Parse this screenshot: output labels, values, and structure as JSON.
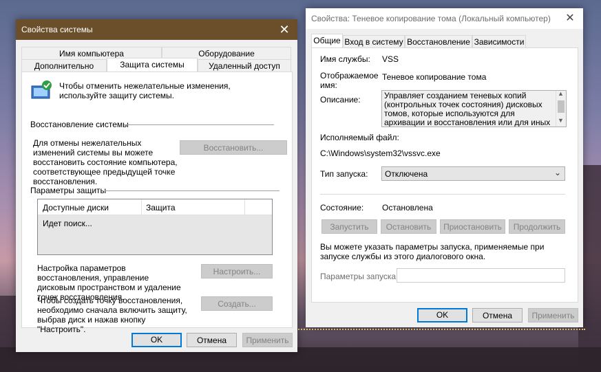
{
  "sys": {
    "title": "Свойства системы",
    "tabs_row1": [
      "Имя компьютера",
      "Оборудование"
    ],
    "tabs_row2": [
      "Дополнительно",
      "Защита системы",
      "Удаленный доступ"
    ],
    "intro": "Чтобы отменить нежелательные изменения, используйте защиту системы.",
    "restore_group": "Восстановление системы",
    "restore_text": "Для отмены нежелательных изменений системы вы можете восстановить состояние компьютера, соответствующее предыдущей точке восстановления.",
    "restore_button": "Восстановить...",
    "protection_group": "Параметры защиты",
    "table_headers": [
      "Доступные диски",
      "Защита"
    ],
    "table_status": "Идет поиск...",
    "configure_text": "Настройка параметров восстановления, управление дисковым пространством и удаление точек восстановления.",
    "configure_button": "Настроить...",
    "create_text": "Чтобы создать точку восстановления, необходимо сначала включить защиту, выбрав диск и нажав кнопку \"Настроить\".",
    "create_button": "Создать...",
    "ok": "OK",
    "cancel": "Отмена",
    "apply": "Применить"
  },
  "svc": {
    "title": "Свойства: Теневое копирование тома (Локальный компьютер)",
    "tabs": [
      "Общие",
      "Вход в систему",
      "Восстановление",
      "Зависимости"
    ],
    "service_name_label": "Имя службы:",
    "service_name": "VSS",
    "display_name_label_1": "Отображаемое",
    "display_name_label_2": "имя:",
    "display_name": "Теневое копирование тома",
    "description_label": "Описание:",
    "description": "Управляет созданием теневых копий (контрольных точек состояния) дисковых томов, которые используются для архивации и восстановления или для иных целей. Если эта",
    "exe_label": "Исполняемый файл:",
    "exe_path": "C:\\Windows\\system32\\vssvc.exe",
    "startup_type_label": "Тип запуска:",
    "startup_type": "Отключена",
    "status_label": "Состояние:",
    "status": "Остановлена",
    "start": "Запустить",
    "stop": "Остановить",
    "pause": "Приостановить",
    "resume": "Продолжить",
    "params_hint": "Вы можете указать параметры запуска, применяемые при запуске службы из этого диалогового окна.",
    "params_label": "Параметры запуска:",
    "params_value": "",
    "ok": "OK",
    "cancel": "Отмена",
    "apply": "Применить"
  }
}
